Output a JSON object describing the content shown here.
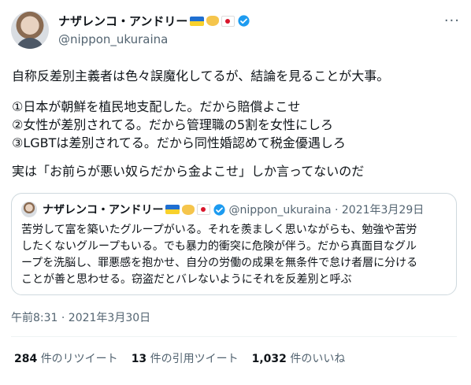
{
  "author": {
    "name": "ナザレンコ・アンドリー",
    "handle": "@nippon_ukuraina"
  },
  "tweet": {
    "lines": [
      "自称反差別主義者は色々誤魔化してるが、結論を見ることが大事。",
      "①日本が朝鮮を植民地支配した。だから賠償よこせ",
      "②女性が差別されてる。だから管理職の5割を女性にしろ",
      "③LGBTは差別されてる。だから同性婚認めて税金優遇しろ",
      "実は「お前らが悪い奴らだから金よこせ」しか言ってないのだ"
    ]
  },
  "quote": {
    "name": "ナザレンコ・アンドリー",
    "meta": "@nippon_ukuraina · 2021年3月29日",
    "lines": [
      "苦労して富を築いたグループがいる。それを羨ましく思いながらも、勉強や苦労",
      "したくないグループもいる。でも暴力的衝突に危険が伴う。だから真面目なグル",
      "ープを洗脳し、罪悪感を抱かせ、自分の労働の成果を無条件で怠け者層に分ける",
      "ことが善と思わせる。窃盗だとバレないようにそれを反差別と呼ぶ"
    ]
  },
  "timestamp": "午前8:31 · 2021年3月30日",
  "stats": {
    "retweets_count": "284",
    "retweets_label": "件のリツイート",
    "quotes_count": "13",
    "quotes_label": "件の引用ツイート",
    "likes_count": "1,032",
    "likes_label": "件のいいね"
  },
  "colors": {
    "text": "#0f1419",
    "secondary": "#536471",
    "verified": "#1d9bf0",
    "border": "#cfd9de"
  },
  "icons": [
    "more-icon",
    "verified-icon",
    "flag-ukraine-icon",
    "handshake-icon",
    "flag-japan-icon"
  ]
}
